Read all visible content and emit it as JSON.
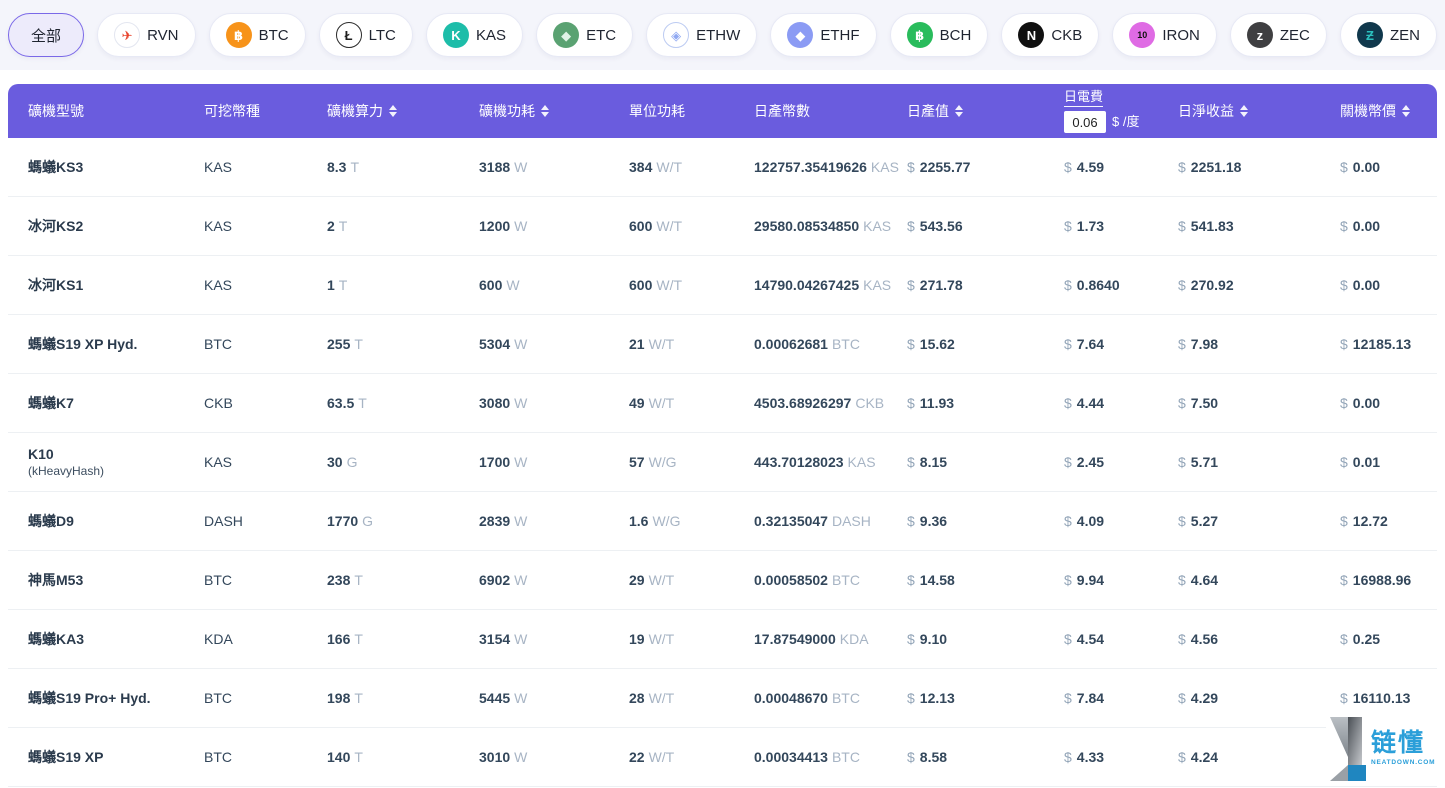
{
  "labels": {
    "currency": "$"
  },
  "filter_bar": {
    "chips": [
      {
        "label": "全部",
        "selected": true,
        "icon": null
      },
      {
        "label": "RVN",
        "icon": {
          "name": "rvn-coin-icon",
          "glyph": "✈",
          "bg": "#ffffff",
          "fg": "#E8432C",
          "border": "#E3E6F0"
        }
      },
      {
        "label": "BTC",
        "icon": {
          "name": "btc-coin-icon",
          "glyph": "฿",
          "bg": "#F7931A",
          "fg": "#ffffff"
        }
      },
      {
        "label": "LTC",
        "icon": {
          "name": "ltc-coin-icon",
          "glyph": "Ł",
          "bg": "#ffffff",
          "fg": "#1E1E1E",
          "border": "#2A2A2A"
        }
      },
      {
        "label": "KAS",
        "icon": {
          "name": "kas-coin-icon",
          "glyph": "K",
          "bg": "#1DBDA9",
          "fg": "#ffffff"
        }
      },
      {
        "label": "ETC",
        "icon": {
          "name": "etc-coin-icon",
          "glyph": "◆",
          "bg": "#5AA272",
          "fg": "#DFF3E6"
        }
      },
      {
        "label": "ETHW",
        "icon": {
          "name": "ethw-coin-icon",
          "glyph": "◈",
          "bg": "#ffffff",
          "fg": "#8FA8F2",
          "border": "#BCCBF2"
        }
      },
      {
        "label": "ETHF",
        "icon": {
          "name": "ethf-coin-icon",
          "glyph": "◆",
          "bg": "#8B9BF4",
          "fg": "#ffffff"
        }
      },
      {
        "label": "BCH",
        "icon": {
          "name": "bch-coin-icon",
          "glyph": "฿",
          "bg": "#29BC5C",
          "fg": "#ffffff"
        }
      },
      {
        "label": "CKB",
        "icon": {
          "name": "ckb-coin-icon",
          "glyph": "N",
          "bg": "#101010",
          "fg": "#ffffff"
        }
      },
      {
        "label": "IRON",
        "icon": {
          "name": "iron-coin-icon",
          "glyph": "10",
          "bg": "#DF6BE4",
          "fg": "#101010"
        }
      },
      {
        "label": "ZEC",
        "icon": {
          "name": "zec-coin-icon",
          "glyph": "z",
          "bg": "#3F3F41",
          "fg": "#ffffff"
        }
      },
      {
        "label": "ZEN",
        "icon": {
          "name": "zen-coin-icon",
          "glyph": "Ƶ",
          "bg": "#10384C",
          "fg": "#2BC0BE"
        }
      }
    ]
  },
  "table": {
    "columns": {
      "model": {
        "label": "礦機型號",
        "sortable": false
      },
      "coin": {
        "label": "可挖幣種",
        "sortable": false
      },
      "hashrate": {
        "label": "礦機算力",
        "sortable": true
      },
      "power": {
        "label": "礦機功耗",
        "sortable": true
      },
      "unit_power": {
        "label": "單位功耗",
        "sortable": false
      },
      "daily_coins": {
        "label": "日產幣數",
        "sortable": false
      },
      "daily_value": {
        "label": "日產值",
        "sortable": true
      },
      "electricity": {
        "label": "日電費",
        "input_value": "0.06",
        "unit": "$ /度"
      },
      "daily_net": {
        "label": "日淨收益",
        "sortable": true
      },
      "shutdown": {
        "label": "關機幣價",
        "sortable": true
      }
    },
    "rows": [
      {
        "model": "螞蟻KS3",
        "model_sub": "",
        "coin": "KAS",
        "hashrate": "8.3",
        "hashrate_unit": "T",
        "power": "3188",
        "power_unit": "W",
        "unit_power": "384",
        "unit_power_unit": "W/T",
        "daily_coins": "122757.35419626",
        "daily_coins_symbol": "KAS",
        "daily_value": "2255.77",
        "electricity": "4.59",
        "daily_net": "2251.18",
        "shutdown": "0.00"
      },
      {
        "model": "冰河KS2",
        "model_sub": "",
        "coin": "KAS",
        "hashrate": "2",
        "hashrate_unit": "T",
        "power": "1200",
        "power_unit": "W",
        "unit_power": "600",
        "unit_power_unit": "W/T",
        "daily_coins": "29580.08534850",
        "daily_coins_symbol": "KAS",
        "daily_value": "543.56",
        "electricity": "1.73",
        "daily_net": "541.83",
        "shutdown": "0.00"
      },
      {
        "model": "冰河KS1",
        "model_sub": "",
        "coin": "KAS",
        "hashrate": "1",
        "hashrate_unit": "T",
        "power": "600",
        "power_unit": "W",
        "unit_power": "600",
        "unit_power_unit": "W/T",
        "daily_coins": "14790.04267425",
        "daily_coins_symbol": "KAS",
        "daily_value": "271.78",
        "electricity": "0.8640",
        "daily_net": "270.92",
        "shutdown": "0.00"
      },
      {
        "model": "螞蟻S19 XP Hyd.",
        "model_sub": "",
        "coin": "BTC",
        "hashrate": "255",
        "hashrate_unit": "T",
        "power": "5304",
        "power_unit": "W",
        "unit_power": "21",
        "unit_power_unit": "W/T",
        "daily_coins": "0.00062681",
        "daily_coins_symbol": "BTC",
        "daily_value": "15.62",
        "electricity": "7.64",
        "daily_net": "7.98",
        "shutdown": "12185.13"
      },
      {
        "model": "螞蟻K7",
        "model_sub": "",
        "coin": "CKB",
        "hashrate": "63.5",
        "hashrate_unit": "T",
        "power": "3080",
        "power_unit": "W",
        "unit_power": "49",
        "unit_power_unit": "W/T",
        "daily_coins": "4503.68926297",
        "daily_coins_symbol": "CKB",
        "daily_value": "11.93",
        "electricity": "4.44",
        "daily_net": "7.50",
        "shutdown": "0.00"
      },
      {
        "model": "K10",
        "model_sub": "(kHeavyHash)",
        "coin": "KAS",
        "hashrate": "30",
        "hashrate_unit": "G",
        "power": "1700",
        "power_unit": "W",
        "unit_power": "57",
        "unit_power_unit": "W/G",
        "daily_coins": "443.70128023",
        "daily_coins_symbol": "KAS",
        "daily_value": "8.15",
        "electricity": "2.45",
        "daily_net": "5.71",
        "shutdown": "0.01"
      },
      {
        "model": "螞蟻D9",
        "model_sub": "",
        "coin": "DASH",
        "hashrate": "1770",
        "hashrate_unit": "G",
        "power": "2839",
        "power_unit": "W",
        "unit_power": "1.6",
        "unit_power_unit": "W/G",
        "daily_coins": "0.32135047",
        "daily_coins_symbol": "DASH",
        "daily_value": "9.36",
        "electricity": "4.09",
        "daily_net": "5.27",
        "shutdown": "12.72"
      },
      {
        "model": "神馬M53",
        "model_sub": "",
        "coin": "BTC",
        "hashrate": "238",
        "hashrate_unit": "T",
        "power": "6902",
        "power_unit": "W",
        "unit_power": "29",
        "unit_power_unit": "W/T",
        "daily_coins": "0.00058502",
        "daily_coins_symbol": "BTC",
        "daily_value": "14.58",
        "electricity": "9.94",
        "daily_net": "4.64",
        "shutdown": "16988.96"
      },
      {
        "model": "螞蟻KA3",
        "model_sub": "",
        "coin": "KDA",
        "hashrate": "166",
        "hashrate_unit": "T",
        "power": "3154",
        "power_unit": "W",
        "unit_power": "19",
        "unit_power_unit": "W/T",
        "daily_coins": "17.87549000",
        "daily_coins_symbol": "KDA",
        "daily_value": "9.10",
        "electricity": "4.54",
        "daily_net": "4.56",
        "shutdown": "0.25"
      },
      {
        "model": "螞蟻S19 Pro+ Hyd.",
        "model_sub": "",
        "coin": "BTC",
        "hashrate": "198",
        "hashrate_unit": "T",
        "power": "5445",
        "power_unit": "W",
        "unit_power": "28",
        "unit_power_unit": "W/T",
        "daily_coins": "0.00048670",
        "daily_coins_symbol": "BTC",
        "daily_value": "12.13",
        "electricity": "7.84",
        "daily_net": "4.29",
        "shutdown": "16110.13"
      },
      {
        "model": "螞蟻S19 XP",
        "model_sub": "",
        "coin": "BTC",
        "hashrate": "140",
        "hashrate_unit": "T",
        "power": "3010",
        "power_unit": "W",
        "unit_power": "22",
        "unit_power_unit": "W/T",
        "daily_coins": "0.00034413",
        "daily_coins_symbol": "BTC",
        "daily_value": "8.58",
        "electricity": "4.33",
        "daily_net": "4.24",
        "shutdown": ""
      }
    ]
  },
  "watermark": {
    "brand": "链懂",
    "domain": "NEATDOWN.COM"
  }
}
